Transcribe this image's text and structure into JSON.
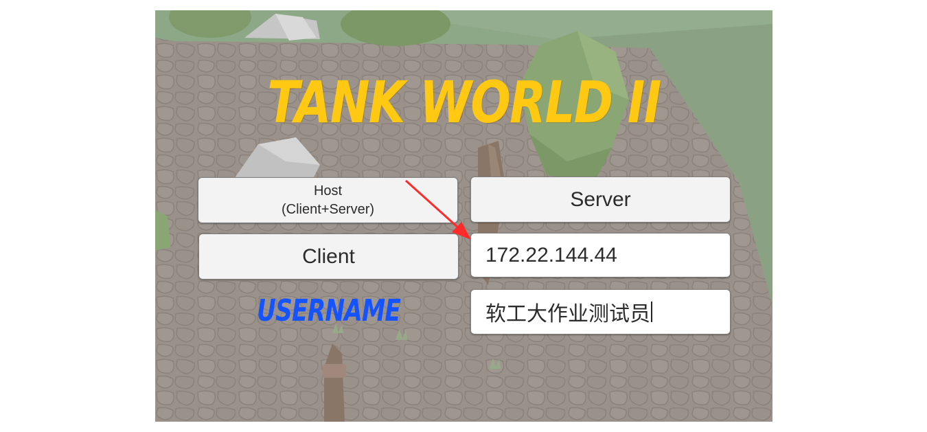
{
  "title": "TANK WORLD II",
  "buttons": {
    "host_line1": "Host",
    "host_line2": "(Client+Server)",
    "server": "Server",
    "client": "Client"
  },
  "inputs": {
    "ip_address": "172.22.144.44",
    "username_value": "软工大作业测试员"
  },
  "labels": {
    "username": "USERNAME"
  },
  "colors": {
    "title": "#ffc812",
    "username_label": "#1553ff",
    "annotation_arrow": "#ff2a2a"
  },
  "icons": [
    "red-annotation-arrow"
  ]
}
